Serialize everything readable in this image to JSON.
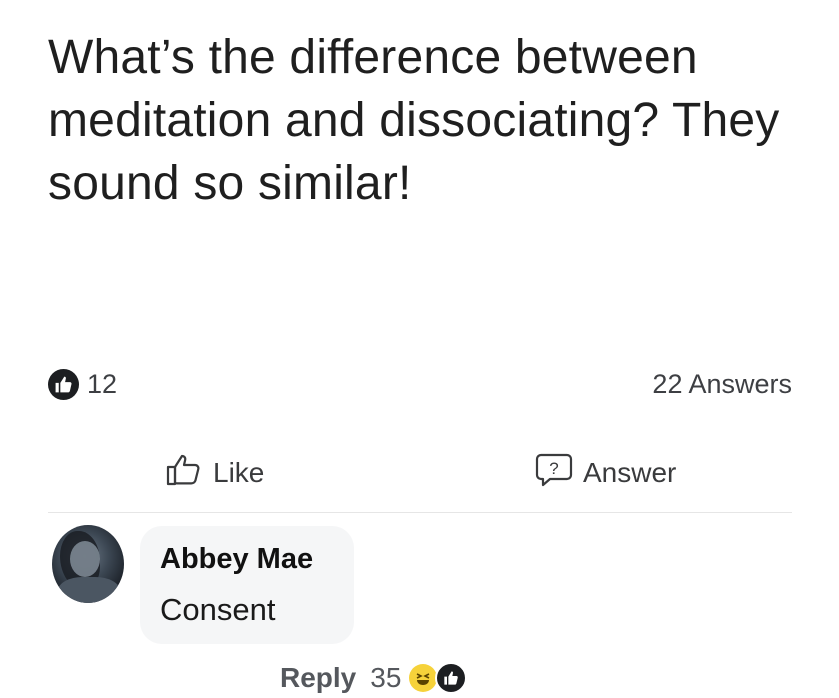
{
  "post": {
    "question": "What’s the difference between meditation and dissociating? They sound so similar!",
    "like_count": "12",
    "answers_count": "22 Answers"
  },
  "actions": {
    "like_label": "Like",
    "answer_label": "Answer"
  },
  "comment": {
    "author": "Abbey Mae",
    "text": "Consent",
    "reply_label": "Reply",
    "reaction_count": "35",
    "reaction_icons": [
      "haha-icon",
      "like-icon"
    ]
  },
  "colors": {
    "text_primary": "#1c1e21",
    "bubble_background": "#f5f6f7",
    "haha_yellow": "#f6d23a"
  }
}
